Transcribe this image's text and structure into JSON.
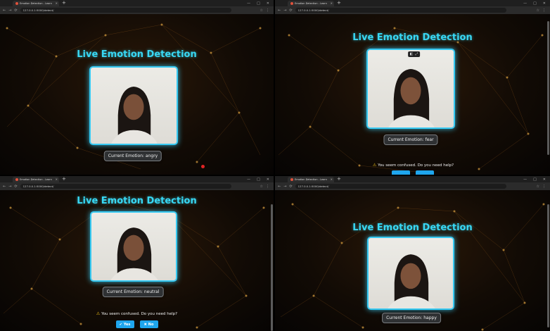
{
  "browser": {
    "tab_title": "Emotion Detection - Learn",
    "tab_close": "×",
    "new_tab": "+",
    "url": "127.0.0.1:5000/detect/",
    "nav_back": "←",
    "nav_forward": "→",
    "nav_reload": "⟳",
    "win_min": "—",
    "win_max": "□",
    "win_close": "✕",
    "addr_icons": [
      "☆",
      "⋮"
    ]
  },
  "app": {
    "heading": "Live Emotion Detection",
    "emotion_prefix": "Current Emotion: ",
    "prompt_text": "You seem confused. Do you need help?",
    "yes_label": "Yes",
    "no_label": "No"
  },
  "panels": [
    {
      "id": "top-left",
      "emotion": "Current Emotion: angry",
      "show_prompt": false
    },
    {
      "id": "top-right",
      "emotion": "Current Emotion: fear",
      "show_prompt": true
    },
    {
      "id": "bottom-left",
      "emotion": "Current Emotion: neutral",
      "show_prompt": true
    },
    {
      "id": "bottom-right",
      "emotion": "Current Emotion: happy",
      "show_prompt": false
    }
  ],
  "colors": {
    "accent": "#38d8f4",
    "frame": "#36c9f2",
    "button": "#1fa6ee",
    "warning": "#f5c518",
    "record": "#e02424"
  },
  "icons": {
    "warning": "warning-icon",
    "yes": "check-icon",
    "no": "close-icon",
    "record": "record-dot-icon"
  }
}
